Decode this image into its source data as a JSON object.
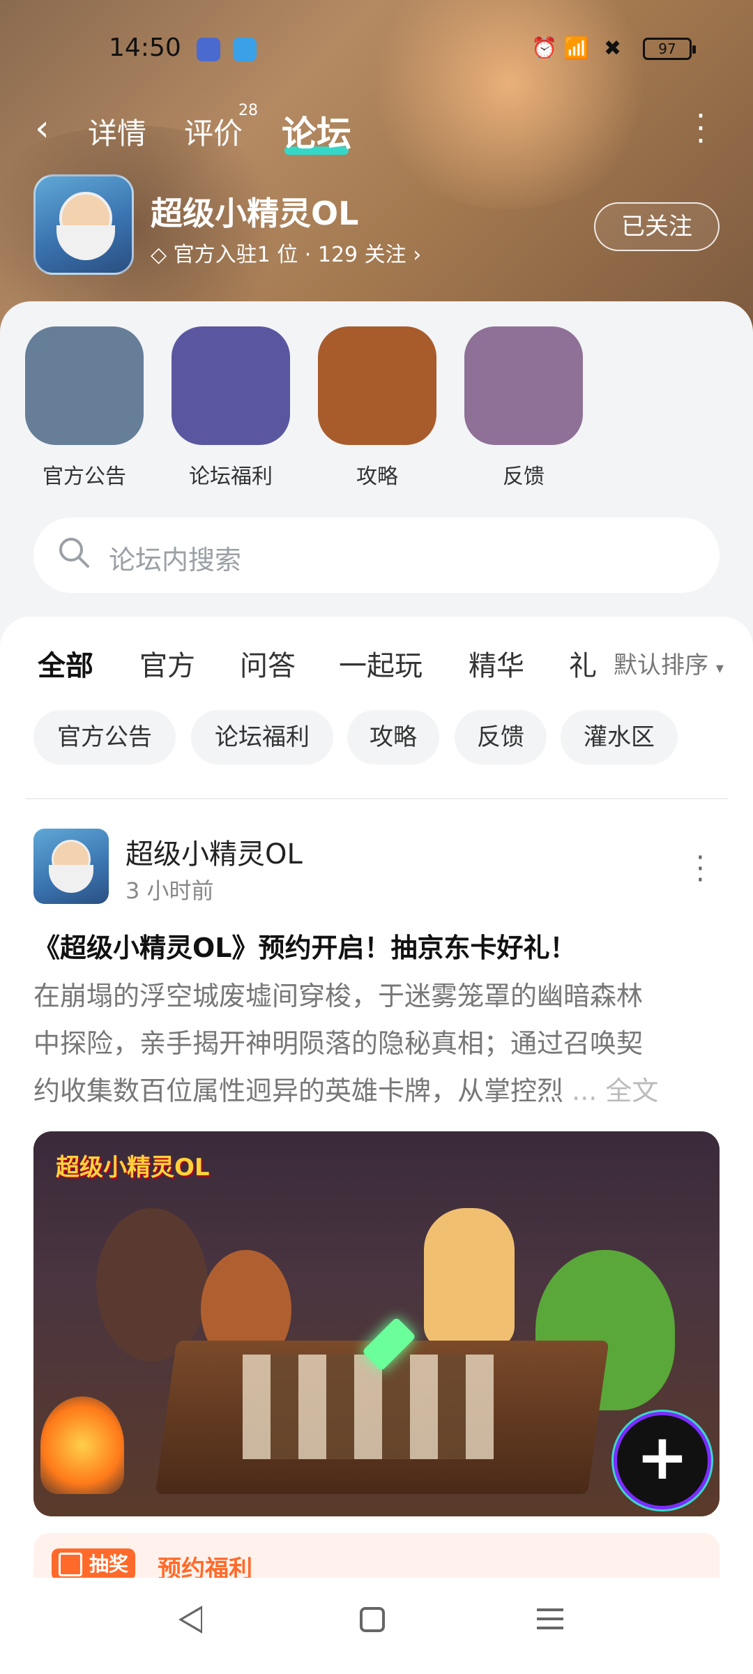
{
  "status": {
    "time": "14:50",
    "battery": "97"
  },
  "header": {
    "tabs": [
      {
        "label": "详情"
      },
      {
        "label": "评价",
        "badge": "28"
      },
      {
        "label": "论坛",
        "active": true
      }
    ],
    "accent": "#35d7c7"
  },
  "app": {
    "title": "超级小精灵OL",
    "subtitle": "官方入驻1 位 · 129 关注",
    "follow_label": "已关注"
  },
  "categories": [
    {
      "label": "官方公告",
      "color": "#667e98"
    },
    {
      "label": "论坛福利",
      "color": "#5a57a0"
    },
    {
      "label": "攻略",
      "color": "#a85c2c"
    },
    {
      "label": "反馈",
      "color": "#8f7197"
    }
  ],
  "search": {
    "placeholder": "论坛内搜索"
  },
  "feed_tabs": [
    "全部",
    "官方",
    "问答",
    "一起玩",
    "精华",
    "礼"
  ],
  "sort_label": "默认排序",
  "chips": [
    "官方公告",
    "论坛福利",
    "攻略",
    "反馈",
    "灌水区"
  ],
  "post": {
    "author": "超级小精灵OL",
    "time": "3 小时前",
    "title": "《超级小精灵OL》预约开启！抽京东卡好礼！",
    "body_lines": [
      "在崩塌的浮空城废墟间穿梭，于迷雾笼罩的幽暗森林",
      "中探险，亲手揭开神明陨落的隐秘真相；通过召唤契",
      "约收集数百位属性迥异的英雄卡牌，从掌控烈"
    ],
    "more_label": "... 全文",
    "image_logo": "超级小精灵OL"
  },
  "promo": {
    "tag": "抽奖",
    "text": "预约福利"
  }
}
